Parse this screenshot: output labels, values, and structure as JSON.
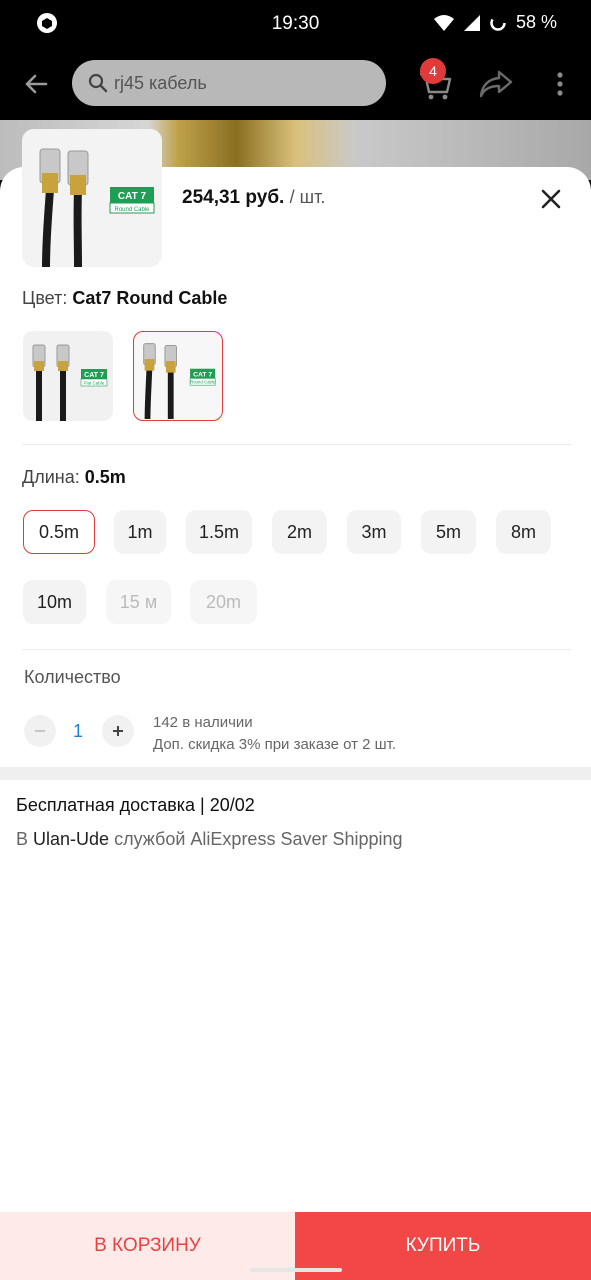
{
  "status_bar": {
    "time": "19:30",
    "battery": "58 %"
  },
  "header": {
    "search_placeholder": "rj45 кабель",
    "cart_count": "4"
  },
  "sheet": {
    "price": "254,31 руб.",
    "price_unit": "/ шт.",
    "color_label": "Цвет:",
    "color_value": "Cat7 Round Cable",
    "color_options": [
      {
        "label_top": "CAT 7",
        "label_bottom": "Flat Cable"
      },
      {
        "label_top": "CAT 7",
        "label_bottom": "Round Cable"
      }
    ],
    "length_label": "Длина:",
    "length_value": "0.5m",
    "lengths": [
      "0.5m",
      "1m",
      "1.5m",
      "2m",
      "3m",
      "5m",
      "8m",
      "10m",
      "15 м",
      "20m"
    ],
    "quantity_label": "Количество",
    "quantity_value": "1",
    "stock_text": "142 в наличии",
    "discount_text": "Доп. скидка 3% при заказе от 2 шт.",
    "delivery_title": "Бесплатная доставка | 20/02",
    "delivery_prefix": "В",
    "delivery_city": "Ulan-Ude",
    "delivery_suffix": "службой AliExpress Saver Shipping"
  },
  "buttons": {
    "add_to_cart": "В КОРЗИНУ",
    "buy": "КУПИТЬ"
  },
  "colors": {
    "accent": "#e03a3a",
    "buy_button": "#f24747",
    "cart_button_bg": "#ffeaea",
    "quantity_text": "#1e7fd6"
  }
}
